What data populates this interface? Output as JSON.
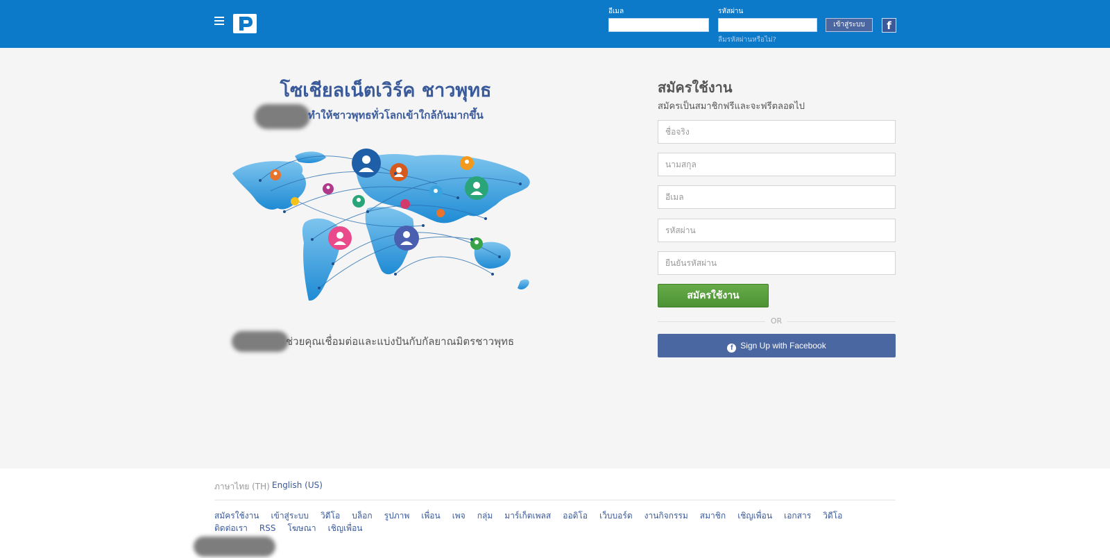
{
  "header": {
    "email_label": "อีเมล",
    "password_label": "รหัสผ่าน",
    "login_button": "เข้าสู่ระบบ",
    "facebook_letter": "f",
    "forgot_password": "ลืมรหัสผ่านหรือไม่?"
  },
  "hero": {
    "title": "โซเชียลเน็ตเวิร์ค ชาวพุทธ",
    "subtitle": "ทำให้ชาวพุทธทั่วโลกเข้าใกล้กันมากขึ้น",
    "tagline": "ช่วยคุณเชื่อมต่อและแบ่งปันกับกัลยาณมิตรชาวพุทธ"
  },
  "signup": {
    "title": "สมัครใช้งาน",
    "subtitle": "สมัครเป็นสมาชิกฟรีและจะฟรีตลอดไป",
    "fields": [
      {
        "placeholder": "ชื่อจริง"
      },
      {
        "placeholder": "นามสกุล"
      },
      {
        "placeholder": "อีเมล"
      },
      {
        "placeholder": "รหัสผ่าน"
      },
      {
        "placeholder": "ยืนยันรหัสผ่าน"
      }
    ],
    "submit_label": "สมัครใช้งาน",
    "or_text": "OR",
    "facebook_label": "Sign Up with Facebook"
  },
  "footer": {
    "current_language": "ภาษาไทย (TH)",
    "other_language": "English (US)",
    "links": [
      "สมัครใช้งาน",
      "เข้าสู่ระบบ",
      "วิดีโอ",
      "บล็อก",
      "รูปภาพ",
      "เพื่อน",
      "เพจ",
      "กลุ่ม",
      "มาร์เก็ตเพลส",
      "ออดิโอ",
      "เว็บบอร์ด",
      "งานกิจกรรม",
      "สมาชิก",
      "เชิญเพื่อน",
      "เอกสาร",
      "วิดีโอ",
      "ติดต่อเรา",
      "RSS",
      "โฆษณา",
      "เชิญเพื่อน"
    ]
  },
  "colors": {
    "header_bg": "#0c7ac9",
    "brand_blue": "#3b5a9a",
    "signup_green": "#5aa03f",
    "facebook_blue": "#4b67a1"
  }
}
